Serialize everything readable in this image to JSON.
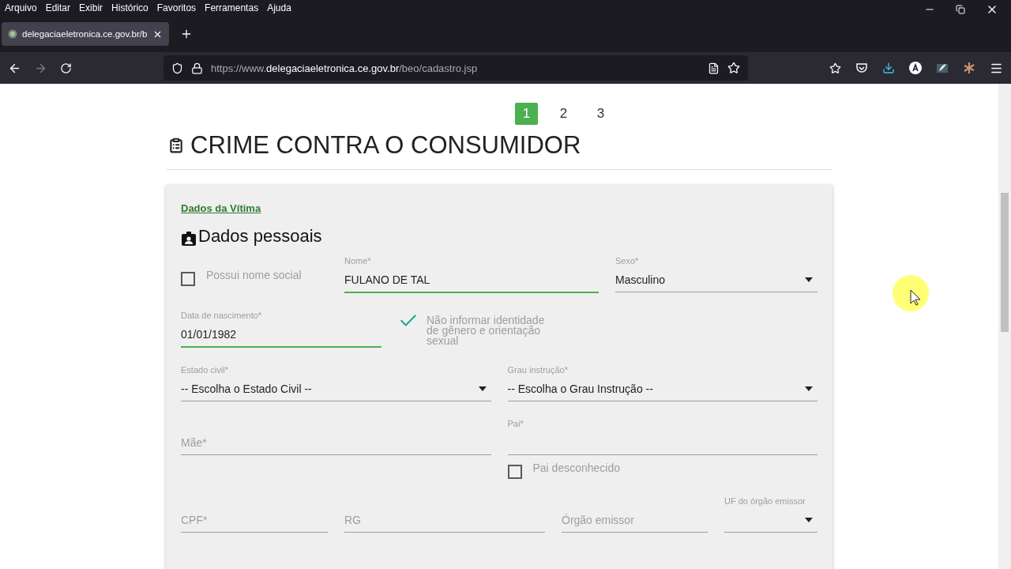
{
  "menu_bar": [
    "Arquivo",
    "Editar",
    "Exibir",
    "Histórico",
    "Favoritos",
    "Ferramentas",
    "Ajuda"
  ],
  "tabs": [
    {
      "title": "delegaciaeletronica.ce.gov.br/b",
      "selected": true
    }
  ],
  "address_bar": {
    "scheme": "https://www.",
    "host": "delegaciaeletronica.ce.gov.br",
    "path": "/beo/cadastro.jsp"
  },
  "steps": [
    {
      "label": "1",
      "selected": true
    },
    {
      "label": "2",
      "selected": false
    },
    {
      "label": "3",
      "selected": false
    }
  ],
  "heading": "CRIME CONTRA O CONSUMIDOR",
  "card": {
    "section_link": "Dados da Vítima",
    "section_title": "Dados pessoais",
    "rows": [
      [
        {
          "kind": "checkbox",
          "label": "Possui nome social",
          "checked": false
        },
        {
          "kind": "input",
          "label": "Nome*",
          "value": "FULANO DE TAL",
          "valid": true
        },
        {
          "kind": "select",
          "label": "Sexo*",
          "value": "Masculino"
        }
      ],
      [
        {
          "kind": "input",
          "label": "Data de nascimento*",
          "value": "01/01/1982",
          "valid": true
        },
        {
          "kind": "checkbox",
          "label": "Não informar identidade de gênero e orientação sexual",
          "checked": true
        }
      ],
      [
        {
          "kind": "select",
          "label": "Estado civil*",
          "value": "-- Escolha o Estado Civil --"
        },
        {
          "kind": "select",
          "label": "Grau instrução*",
          "value": "-- Escolha o Grau Instrução --"
        }
      ],
      [
        {
          "kind": "input",
          "placeholder": "Mãe*",
          "valid": false
        },
        {
          "kind": "input",
          "label": "Pai*",
          "valid": false,
          "checkbox": {
            "label": "Pai desconhecido",
            "checked": false
          }
        }
      ],
      [
        {
          "kind": "input",
          "placeholder": "CPF*",
          "valid": false
        },
        {
          "kind": "input",
          "placeholder": "RG",
          "valid": false
        },
        {
          "kind": "input",
          "placeholder": "Órgão emissor",
          "valid": false
        },
        {
          "kind": "select",
          "label": "UF do órgão emissor"
        }
      ]
    ]
  }
}
